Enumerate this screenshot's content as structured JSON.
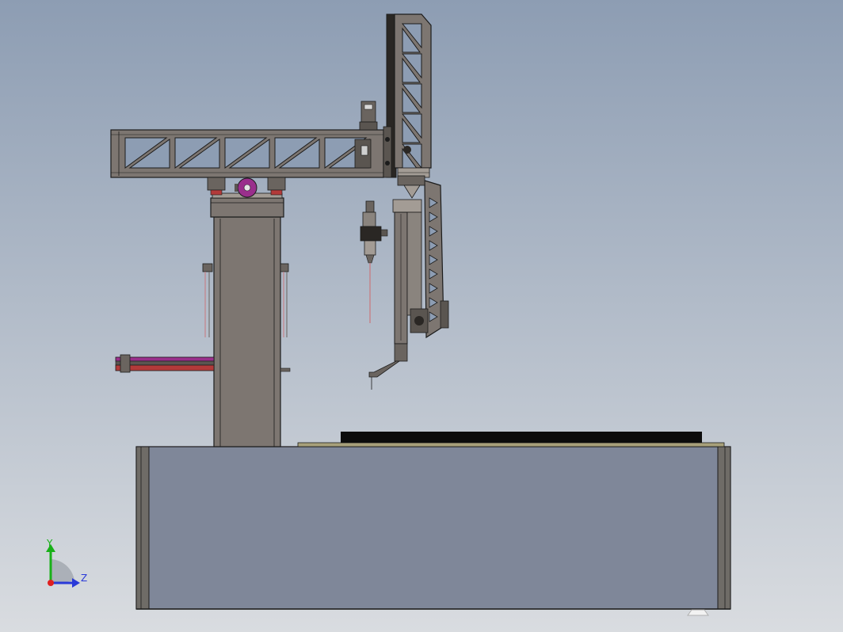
{
  "viewport": {
    "background_top": "#8d9db3",
    "background_bottom": "#d9dce0"
  },
  "colors": {
    "steel": "#7d7671",
    "steel_dark": "#4e4944",
    "steel_light": "#a39c95",
    "outline": "#1c1c1c",
    "base_panel": "#7f8799",
    "base_side": "#6f6c67",
    "table_top": "#0c0c0c",
    "table_plate": "#a7a07a",
    "accent_purple": "#9a2f8c",
    "accent_red": "#b23a3a",
    "laser_line": "#c9777c",
    "triad_x": "#e02020",
    "triad_y": "#18b018",
    "triad_z": "#2a3ad8"
  },
  "triad": {
    "y_label": "Y",
    "z_label": "Z"
  }
}
